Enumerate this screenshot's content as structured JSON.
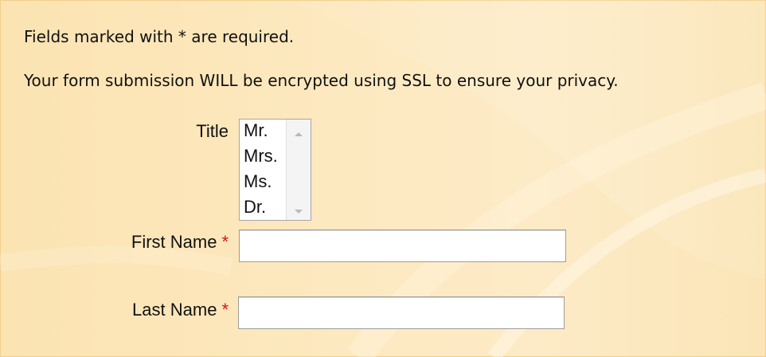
{
  "form": {
    "required_notice": "Fields marked with * are required.",
    "ssl_notice": "Your form submission WILL be encrypted using SSL to ensure your privacy.",
    "title": {
      "label": "Title",
      "options": [
        "Mr.",
        "Mrs.",
        "Ms.",
        "Dr."
      ]
    },
    "first_name": {
      "label": "First Name",
      "required_marker": "*",
      "value": "",
      "placeholder": ""
    },
    "last_name": {
      "label": "Last Name",
      "required_marker": "*",
      "value": "",
      "placeholder": ""
    }
  },
  "colors": {
    "background": "#fde9c0",
    "required_marker": "#d01818",
    "text": "#111111"
  }
}
